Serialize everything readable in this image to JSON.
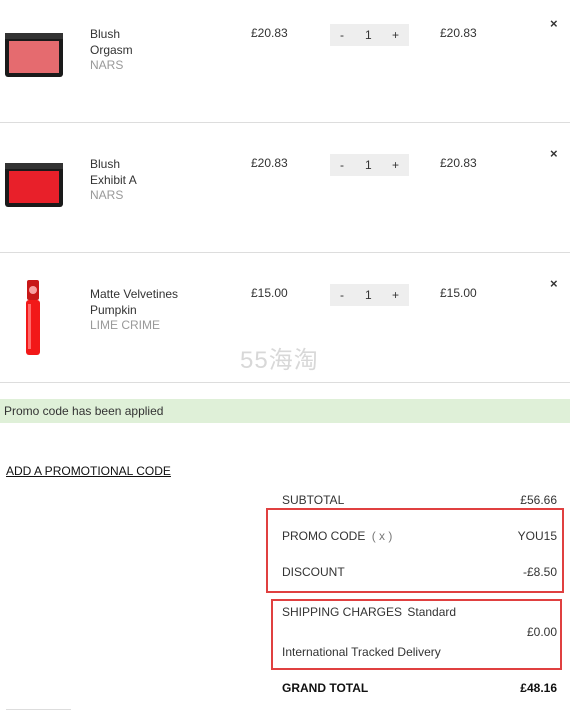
{
  "cart": {
    "items": [
      {
        "name": "Blush Orgasm",
        "name_lines": [
          "Blush",
          "Orgasm"
        ],
        "brand": "NARS",
        "price": "£20.83",
        "qty": "1",
        "total": "£20.83",
        "swatch": "#e56b6f"
      },
      {
        "name": "Blush Exhibit A",
        "name_lines": [
          "Blush",
          "Exhibit A"
        ],
        "brand": "NARS",
        "price": "£20.83",
        "qty": "1",
        "total": "£20.83",
        "swatch": "#e8202a"
      },
      {
        "name": "Matte Velvetines Pumpkin",
        "name_lines": [
          "Matte Velvetines",
          "Pumpkin"
        ],
        "brand": "LIME CRIME",
        "price": "£15.00",
        "qty": "1",
        "total": "£15.00",
        "swatch": "#f21818"
      }
    ],
    "qty_minus": "-",
    "qty_plus": "+",
    "remove_glyph": "×"
  },
  "watermark": "55海淘",
  "notice": {
    "text": "Promo code has been applied",
    "bg": "#dff0d8"
  },
  "promo_link": "ADD A PROMOTIONAL CODE",
  "summary": {
    "subtotal_label": "SUBTOTAL",
    "subtotal_value": "£56.66",
    "promo_label": "PROMO CODE",
    "promo_remove": "( x )",
    "promo_value": "YOU15",
    "discount_label": "DISCOUNT",
    "discount_value": "-£8.50",
    "shipping_label": "SHIPPING CHARGES",
    "shipping_type": "Standard",
    "shipping_value": "£0.00",
    "shipping_method": "International Tracked Delivery",
    "grand_total_label": "GRAND TOTAL",
    "grand_total_value": "£48.16"
  },
  "colors": {
    "highlight_border": "#e04040",
    "divider": "#dddddd"
  }
}
